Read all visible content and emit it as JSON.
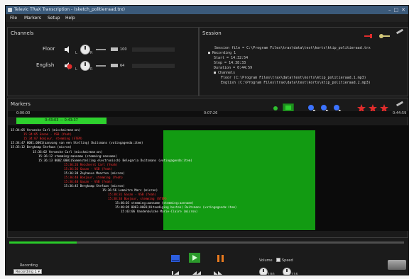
{
  "window": {
    "title": "Televic TRaX Transcription - (sketch_politierraad.trx)",
    "controls": [
      "–",
      "□",
      "✕"
    ]
  },
  "menu": {
    "items": [
      "File",
      "Markers",
      "Setup",
      "Help"
    ]
  },
  "channels_panel": {
    "title": "Channels",
    "channels": [
      {
        "name": "Floor",
        "level": "100",
        "knob_letters": [
          "L",
          "R"
        ]
      },
      {
        "name": "English",
        "level": "64",
        "knob_letters": [
          "L",
          "R"
        ]
      }
    ]
  },
  "session_panel": {
    "title": "Session",
    "lines": [
      "Session file = C:\\Program Files\\trax\\data\\test\\korts\\ktip_politieraad.trx",
      "Recording 1",
      "Start = 14:32:54",
      "Stop = 14:38:33",
      "Duration = 0:44:59",
      "Channels",
      "Floor (C:\\Program Files\\trax\\data\\test\\korts\\ktip_politieraad.1.mp3)",
      "English (C:\\Program Files\\trax\\data\\test\\korts\\ktip_politieraad.2.mp3)"
    ]
  },
  "markers_panel": {
    "title": "Markers",
    "time_start": "0:00:00",
    "time_mid": "0:07:26",
    "time_end": "0:44:59",
    "green_range_label": "0:43:03 — 0:43:37",
    "transcript_lines": [
      {
        "text": "15:34:05 Verwecke Carl (micchairman:on)",
        "red": false
      },
      {
        "text": "15:34:05 Gasan - VSB (Yeah)",
        "red": true
      },
      {
        "text": "15:34:07 Bonjour, stemming (STEM)",
        "red": true
      },
      {
        "text": "15:34:47 0001.0001(aanvang van een Stelling) Duitsmans (votingagenda:item)",
        "red": false
      },
      {
        "text": "15:35:12 Bergkamp Stefaan (micron)",
        "red": false
      },
      {
        "text": "15:36:02 Verwecke Carl (micchairman:on)",
        "red": false
      },
      {
        "text": "15:36:12 stemming:aanname (stemming:aanname)",
        "red": false
      },
      {
        "text": "15:36:13 0002.0001(Samenstelling electronisch) Belegaria Duitsmans (votingagenda:item)",
        "red": false
      },
      {
        "text": "15:36:26 Reicherst Carl (Yeah)",
        "red": true
      },
      {
        "text": "15:36:36 Gasan - VSB (Yeah)",
        "red": true
      },
      {
        "text": "15:36:38 Zeyhaeve Maarten (micron)",
        "red": false
      },
      {
        "text": "15:36:40 Bonjour, stemming (Yeah)",
        "red": true
      },
      {
        "text": "15:36:40 Gasan - VSB (Yeah)",
        "red": true
      },
      {
        "text": "15:36:45 Bergkamp Stefaan (micron)",
        "red": false
      },
      {
        "text": "15:36:56 Lemaitre Marc (micron)",
        "red": false
      },
      {
        "text": "15:38:31 Gasan - VSB (Yeah)",
        "red": true
      },
      {
        "text": "15:38:34 Bonjour, stemming (STEM)",
        "red": true
      },
      {
        "text": "15:40:03 stemming:aanname (stemming:aanname)",
        "red": false
      },
      {
        "text": "15:40:09 0003.0001(Uitnodiging bestek) Duitsmans (votingagenda:item)",
        "red": false
      },
      {
        "text": "15:43:06 Vandenbulcke Marie-Claire (micron)",
        "red": false
      }
    ]
  },
  "playback": {
    "progress": 0.17,
    "recording_label": "Recording",
    "recording_value": "Recording 1",
    "volume_label": "Volume",
    "speed_label": "Speed",
    "volume_value": "100",
    "speed_value": "116"
  },
  "colors": {
    "accent_green": "#2ed12e",
    "marker_red": "#ff3030",
    "play_green": "#2b9a2b",
    "stop_blue": "#2d5fe0",
    "pause_orange": "#e87a1f"
  }
}
